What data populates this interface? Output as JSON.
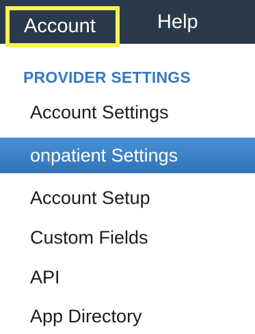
{
  "menubar": {
    "items": [
      {
        "label": "Account",
        "highlighted": true
      },
      {
        "label": "Help"
      }
    ]
  },
  "dropdown": {
    "section_title": "PROVIDER SETTINGS",
    "items": [
      {
        "label": "Account Settings"
      },
      {
        "label": "onpatient Settings",
        "active": true
      },
      {
        "label": "Account Setup"
      },
      {
        "label": "Custom Fields"
      },
      {
        "label": "API"
      },
      {
        "label": "App Directory"
      }
    ]
  },
  "colors": {
    "menubar_bg": "#2b3a4a",
    "highlight_border": "#f5f255",
    "section_title": "#3779c1",
    "active_item_bg": "#3b82c8"
  }
}
